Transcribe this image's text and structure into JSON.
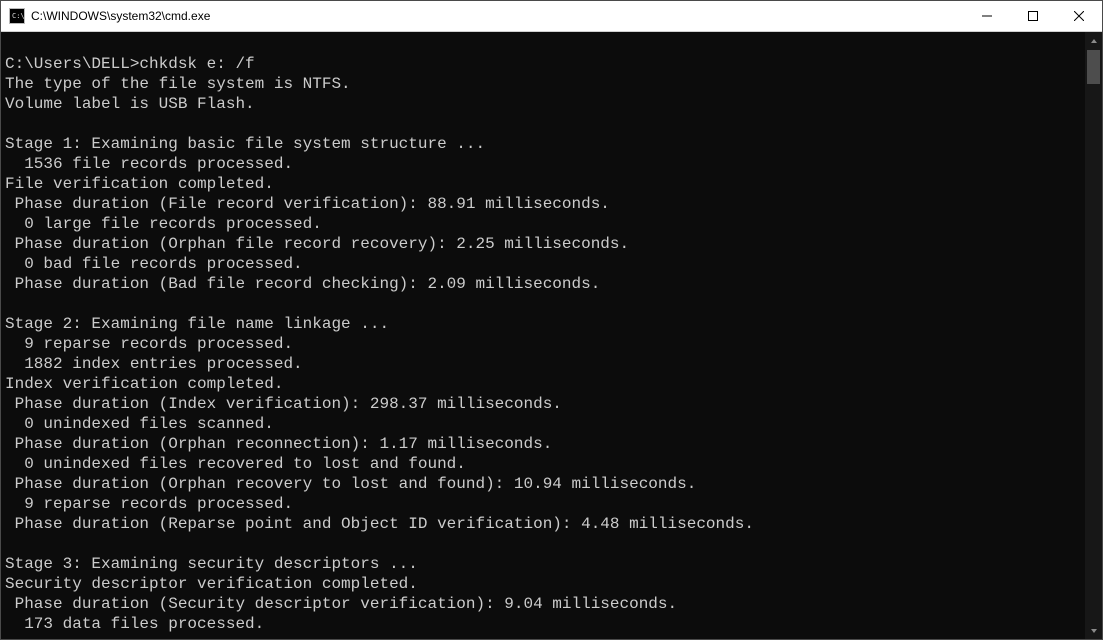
{
  "titlebar": {
    "title": "C:\\WINDOWS\\system32\\cmd.exe"
  },
  "console": {
    "lines": [
      "",
      "C:\\Users\\DELL>chkdsk e: /f",
      "The type of the file system is NTFS.",
      "Volume label is USB Flash.",
      "",
      "Stage 1: Examining basic file system structure ...",
      "  1536 file records processed.",
      "File verification completed.",
      " Phase duration (File record verification): 88.91 milliseconds.",
      "  0 large file records processed.",
      " Phase duration (Orphan file record recovery): 2.25 milliseconds.",
      "  0 bad file records processed.",
      " Phase duration (Bad file record checking): 2.09 milliseconds.",
      "",
      "Stage 2: Examining file name linkage ...",
      "  9 reparse records processed.",
      "  1882 index entries processed.",
      "Index verification completed.",
      " Phase duration (Index verification): 298.37 milliseconds.",
      "  0 unindexed files scanned.",
      " Phase duration (Orphan reconnection): 1.17 milliseconds.",
      "  0 unindexed files recovered to lost and found.",
      " Phase duration (Orphan recovery to lost and found): 10.94 milliseconds.",
      "  9 reparse records processed.",
      " Phase duration (Reparse point and Object ID verification): 4.48 milliseconds.",
      "",
      "Stage 3: Examining security descriptors ...",
      "Security descriptor verification completed.",
      " Phase duration (Security descriptor verification): 9.04 milliseconds.",
      "  173 data files processed."
    ]
  }
}
